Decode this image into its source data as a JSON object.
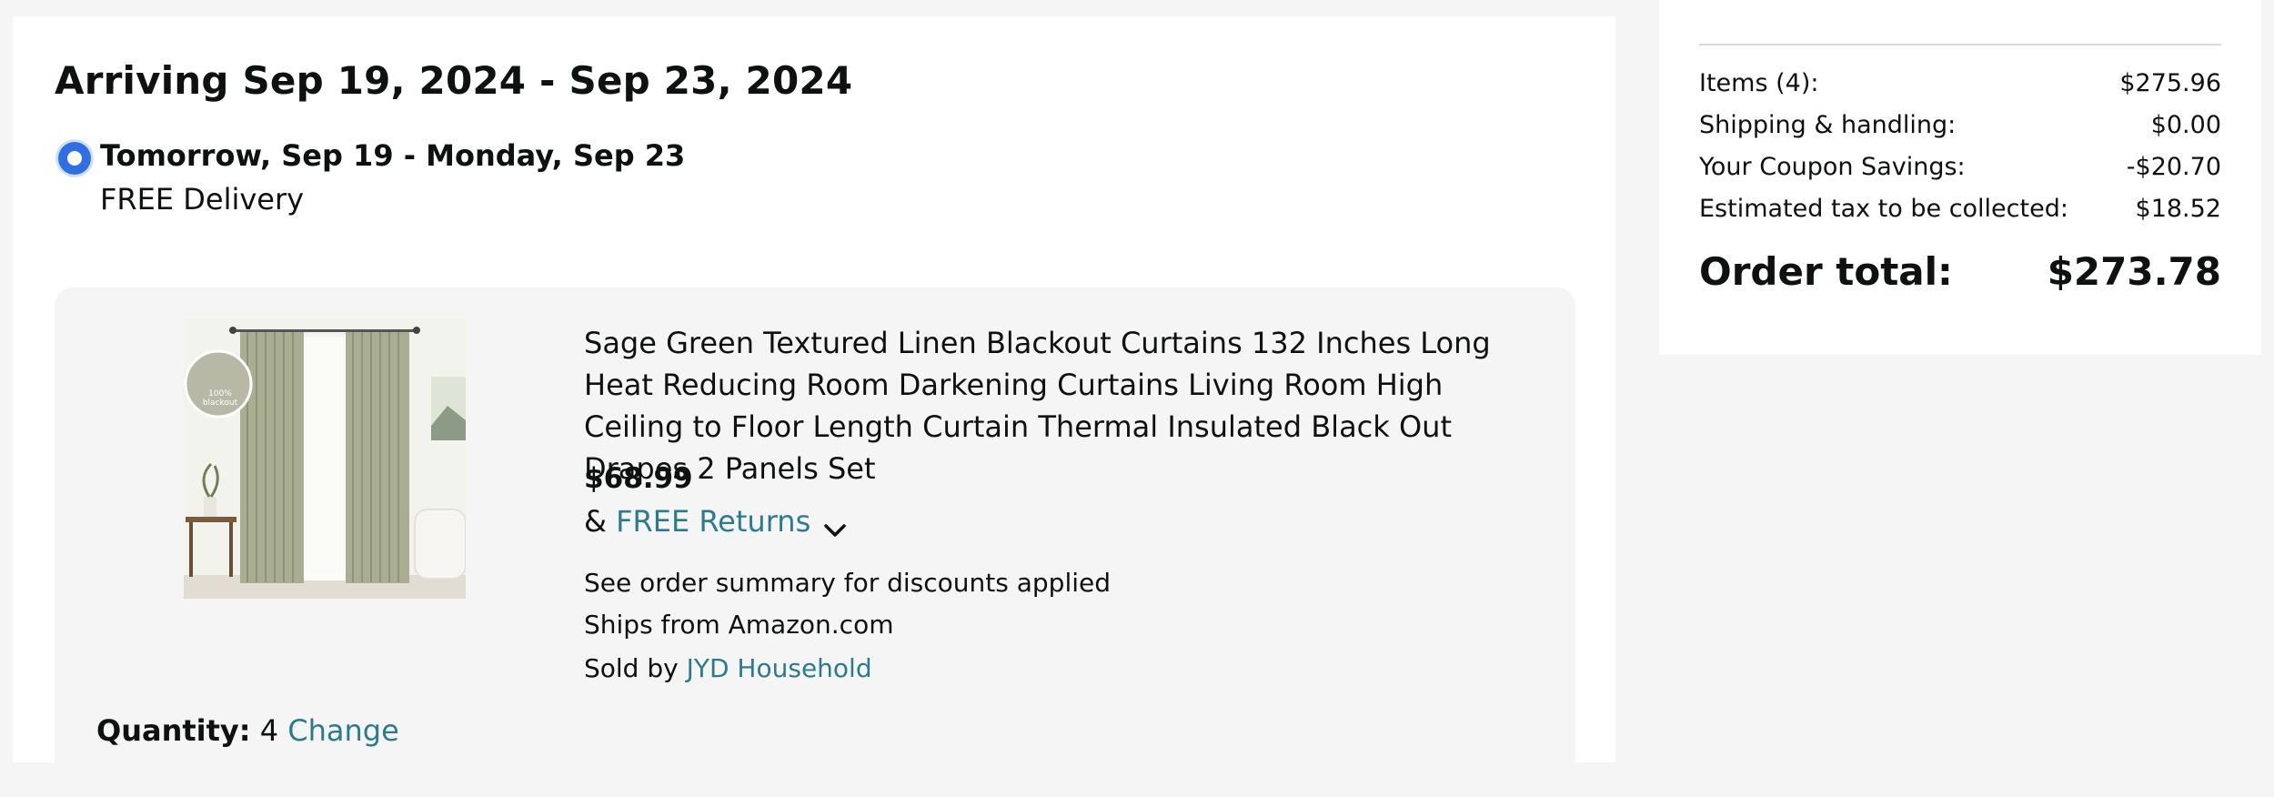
{
  "delivery": {
    "arriving_heading": "Arriving Sep 19, 2024 - Sep 23, 2024",
    "option_title": "Tomorrow, Sep 19 - Monday, Sep 23",
    "option_subtitle": "FREE Delivery"
  },
  "item": {
    "image_caption": "100% blackout",
    "title": "Sage Green Textured Linen Blackout Curtains 132 Inches Long Heat Reducing Room Darkening Curtains Living Room High Ceiling to Floor Length Curtain Thermal Insulated Black Out Drapes 2 Panels Set",
    "price": "$68.99",
    "returns_prefix": "& ",
    "returns_link": "FREE Returns",
    "discount_note": "See order summary for discounts applied",
    "ships_from": "Ships from Amazon.com",
    "sold_by_prefix": "Sold by ",
    "sold_by_link": "JYD Household",
    "quantity_label": "Quantity:",
    "quantity_value": "4",
    "quantity_change": "Change"
  },
  "summary": {
    "rows": [
      {
        "label": "Items (4):",
        "value": "$275.96"
      },
      {
        "label": "Shipping & handling:",
        "value": "$0.00"
      },
      {
        "label": "Your Coupon Savings:",
        "value": "-$20.70"
      },
      {
        "label": "Estimated tax to be collected:",
        "value": "$18.52"
      }
    ],
    "total_label": "Order total:",
    "total_value": "$273.78"
  },
  "icons": {
    "radio": "radio-selected-icon",
    "returns_toggle": "chevron-down-icon"
  },
  "colors": {
    "link": "#2c7a8e",
    "radio": "#2f6ee3",
    "page_bg": "#f5f5f5",
    "item_bg": "#f5f5f5"
  }
}
